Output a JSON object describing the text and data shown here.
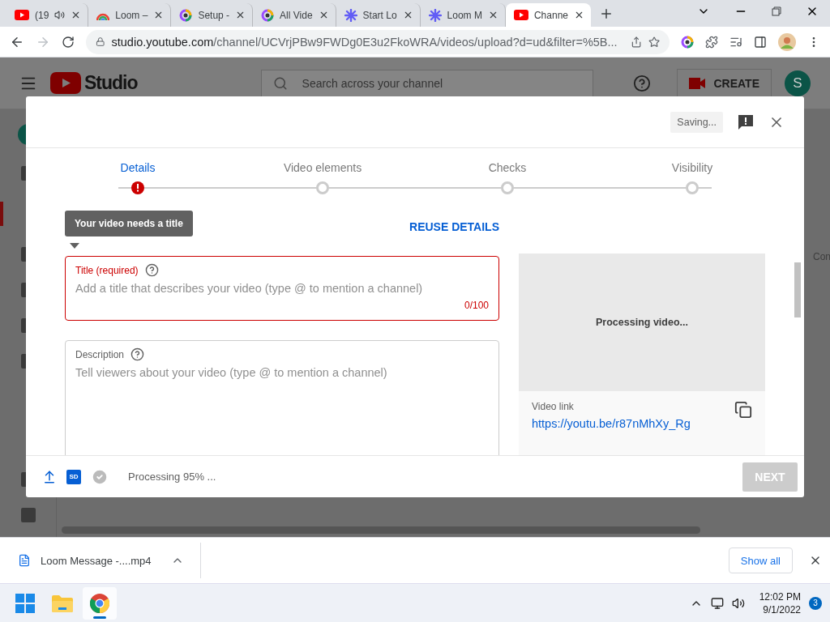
{
  "browser": {
    "tabs": [
      {
        "title": "(19",
        "kind": "youtube",
        "audio": true,
        "selected": false
      },
      {
        "title": "Loom –",
        "kind": "rainbow",
        "audio": false,
        "selected": false
      },
      {
        "title": "Setup -",
        "kind": "ring",
        "audio": false,
        "selected": false
      },
      {
        "title": "All Vide",
        "kind": "ring",
        "audio": false,
        "selected": false
      },
      {
        "title": "Start Lo",
        "kind": "star",
        "audio": false,
        "selected": false
      },
      {
        "title": "Loom M",
        "kind": "star",
        "audio": false,
        "selected": false
      },
      {
        "title": "Channe",
        "kind": "youtube",
        "audio": false,
        "selected": true
      }
    ],
    "address": {
      "host": "studio.youtube.com",
      "path": "/channel/UCVrjPBw9FWDg0E3u2FkoWRA/videos/upload?d=ud&filter=%5B..."
    }
  },
  "studio": {
    "logo": "Studio",
    "search_placeholder": "Search across your channel",
    "create": "CREATE",
    "avatar": "S",
    "side_text": "Con"
  },
  "dialog": {
    "saving": "Saving...",
    "steps": [
      {
        "label": "Details",
        "selected": true,
        "error": true
      },
      {
        "label": "Video elements",
        "selected": false,
        "error": false
      },
      {
        "label": "Checks",
        "selected": false,
        "error": false
      },
      {
        "label": "Visibility",
        "selected": false,
        "error": false
      }
    ],
    "reuse_details": "REUSE DETAILS",
    "tooltip": "Your video needs a title",
    "title_field": {
      "label": "Title (required)",
      "placeholder": "Add a title that describes your video (type @ to mention a channel)",
      "counter": "0/100",
      "error": true
    },
    "description_field": {
      "label": "Description",
      "placeholder": "Tell viewers about your video (type @ to mention a channel)"
    },
    "preview": {
      "status": "Processing video...",
      "link_label": "Video link",
      "link": "https://youtu.be/r87nMhXy_Rg"
    },
    "footer": {
      "quality": "SD",
      "status": "Processing 95% ...",
      "next": {
        "label": "NEXT",
        "disabled": true
      }
    }
  },
  "downloads": {
    "file": "Loom Message -....mp4",
    "show_all": "Show all"
  },
  "taskbar": {
    "apps": [
      {
        "kind": "start",
        "selected": false
      },
      {
        "kind": "folder",
        "selected": false
      },
      {
        "kind": "chrome",
        "selected": true
      }
    ],
    "time": "12:02 PM",
    "date": "9/1/2022",
    "badge": "3"
  }
}
